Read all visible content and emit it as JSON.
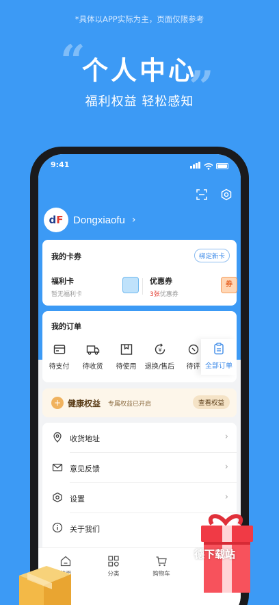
{
  "promo": {
    "note": "*具体以APP实际为主，页面仅限参考",
    "title": "个人中心",
    "subtitle": "福利权益 轻松感知",
    "quote_open": "“",
    "quote_close": "”"
  },
  "status_bar": {
    "time": "9:41"
  },
  "header": {
    "icons": [
      "scan-icon",
      "settings-icon"
    ]
  },
  "user": {
    "avatar_text_1": "d",
    "avatar_text_2": "F",
    "name": "Dongxiaofu",
    "chevron": "›"
  },
  "cards": {
    "title": "我的卡券",
    "bind_label": "绑定新卡",
    "welfare": {
      "name": "福利卡",
      "desc": "暂无福利卡"
    },
    "coupon": {
      "name": "优惠券",
      "count": "3张",
      "desc_suffix": "优惠券",
      "icon_text": "券"
    }
  },
  "orders": {
    "title": "我的订单",
    "items": [
      {
        "label": "待支付",
        "icon": "wallet-icon"
      },
      {
        "label": "待收货",
        "icon": "truck-icon"
      },
      {
        "label": "待使用",
        "icon": "box-icon"
      },
      {
        "label": "退换/售后",
        "icon": "refund-icon"
      },
      {
        "label": "待评",
        "icon": "review-icon"
      }
    ],
    "all_label": "全部订单"
  },
  "health": {
    "icon_text": "+",
    "title": "健康权益",
    "subtitle": "专属权益已开启",
    "button": "查看权益"
  },
  "menu": [
    {
      "label": "收货地址",
      "icon": "location-icon"
    },
    {
      "label": "意见反馈",
      "icon": "mail-icon"
    },
    {
      "label": "设置",
      "icon": "settings-hex-icon"
    },
    {
      "label": "关于我们",
      "icon": "info-icon"
    }
  ],
  "tabbar": [
    {
      "label": "首页",
      "icon": "home-icon"
    },
    {
      "label": "分类",
      "icon": "category-icon"
    },
    {
      "label": "购物车",
      "icon": "cart-icon"
    }
  ],
  "overlay": {
    "watermark": "德下载站"
  },
  "colors": {
    "brand": "#3c9af5",
    "accent_link": "#3c8ae8",
    "red": "#e23b2f"
  }
}
